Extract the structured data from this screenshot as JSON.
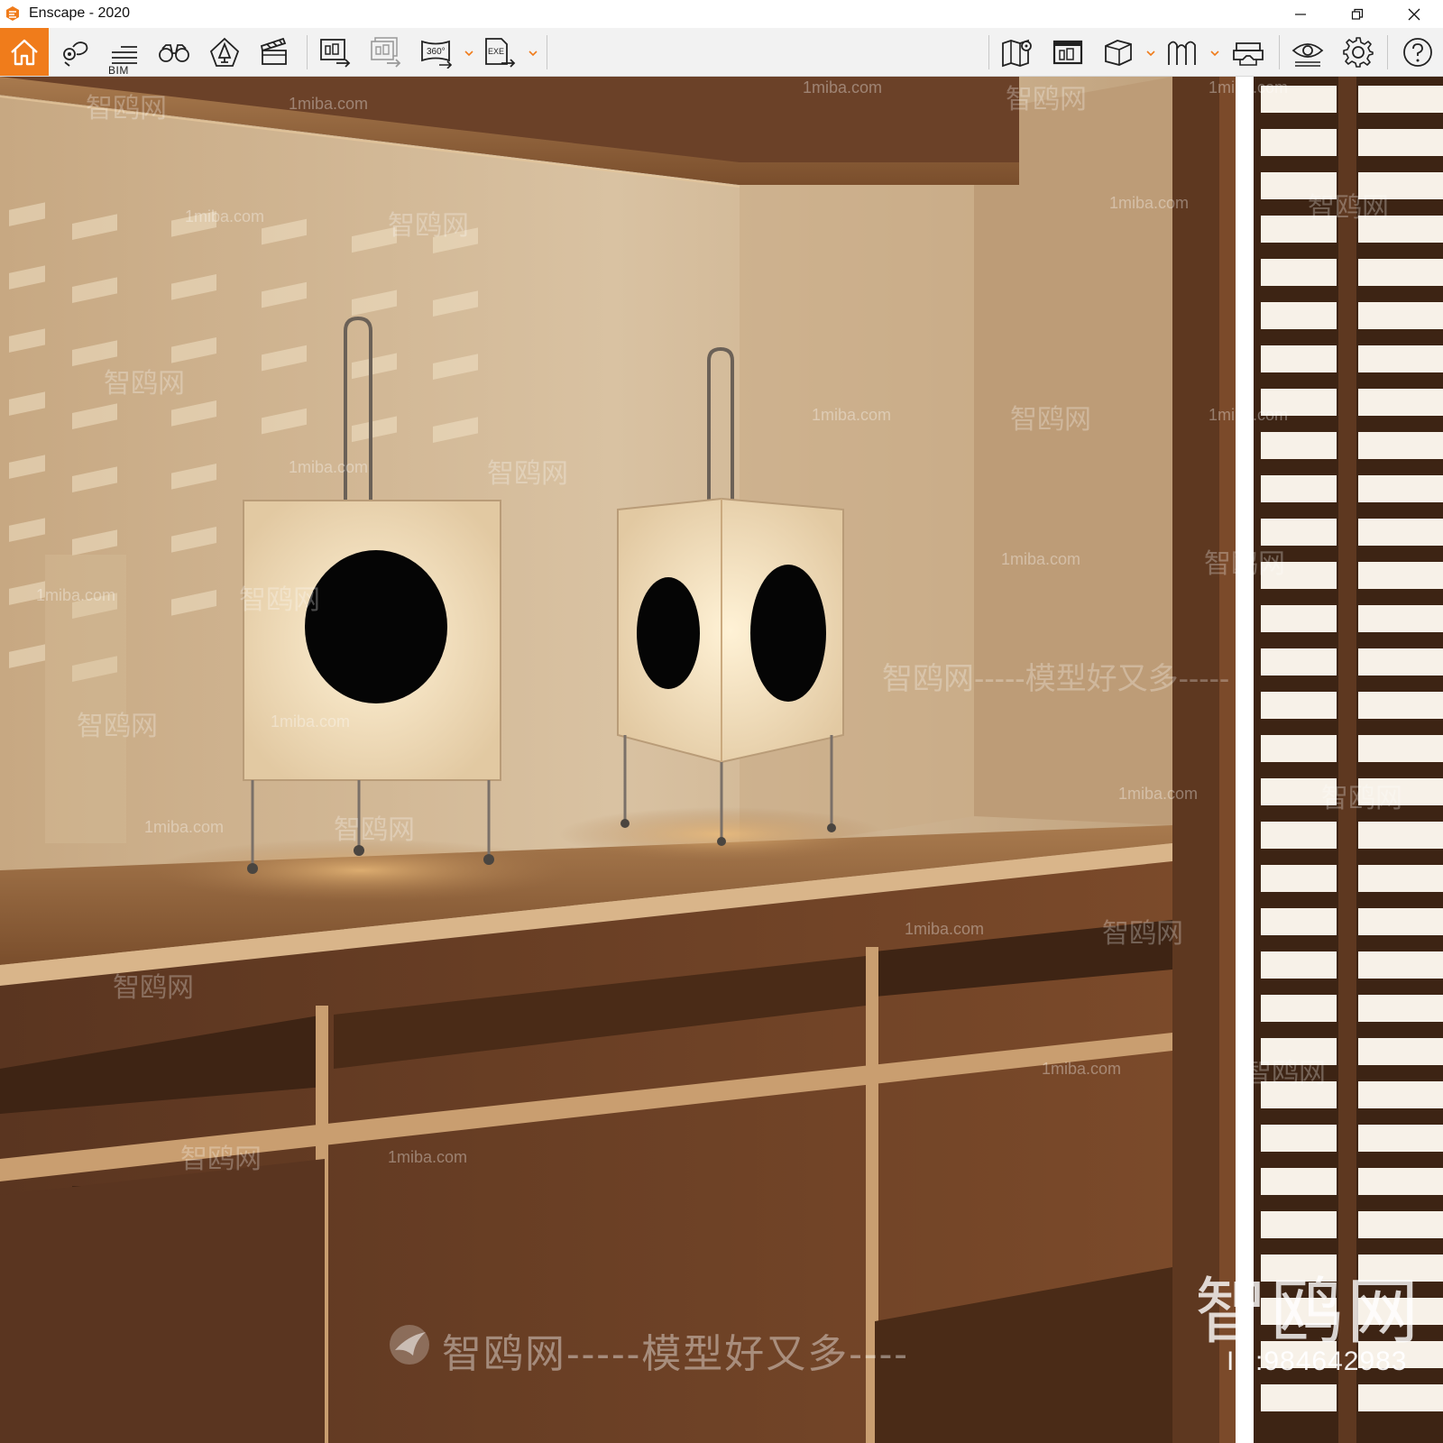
{
  "window": {
    "title": "Enscape - 2020",
    "minimize_icon": "minimize-icon",
    "restore_icon": "restore-icon",
    "close_icon": "close-icon"
  },
  "toolbar": {
    "accent_color": "#f07c1b",
    "left_tools": [
      {
        "name": "home",
        "icon": "home-icon"
      },
      {
        "name": "views",
        "icon": "location-pin-icon"
      },
      {
        "name": "bim",
        "icon": "bim-list-icon",
        "label": "BIM"
      },
      {
        "name": "walk",
        "icon": "binoculars-icon"
      },
      {
        "name": "assets",
        "icon": "tree-asset-icon"
      },
      {
        "name": "video-editor",
        "icon": "clapperboard-icon"
      },
      {
        "name": "render-image",
        "icon": "render-image-icon"
      },
      {
        "name": "batch-render",
        "icon": "batch-render-icon"
      },
      {
        "name": "render-panorama",
        "icon": "panorama-360-icon",
        "label": "360°"
      },
      {
        "name": "export-exe",
        "icon": "export-exe-icon",
        "label": "EXE"
      }
    ],
    "right_tools": [
      {
        "name": "map",
        "icon": "map-icon"
      },
      {
        "name": "screenshot",
        "icon": "gallery-icon"
      },
      {
        "name": "section",
        "icon": "box-section-icon"
      },
      {
        "name": "atmosphere",
        "icon": "atmosphere-icon"
      },
      {
        "name": "vr-headset",
        "icon": "vr-headset-icon"
      },
      {
        "name": "visual-settings",
        "icon": "eye-icon"
      },
      {
        "name": "settings",
        "icon": "gear-icon"
      },
      {
        "name": "help",
        "icon": "help-icon"
      }
    ],
    "collapse_icon": "chevron-up-icon"
  },
  "viewport": {
    "watermarks": {
      "site": "1miba.com",
      "brand": "智鸥网",
      "slogan_line": "智鸥网-----模型好又多-----",
      "big_brand": "智鸥网",
      "id_text": "ID:984642983",
      "bottom_slogan": "智鸥网-----模型好又多----"
    }
  }
}
